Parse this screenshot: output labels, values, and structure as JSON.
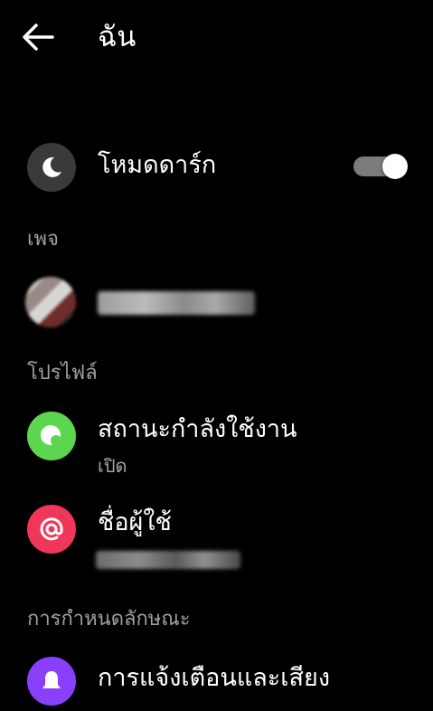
{
  "header": {
    "title": "ฉัน"
  },
  "dark_mode": {
    "label": "โหมดดาร์ก",
    "enabled": true
  },
  "sections": {
    "page": "เพจ",
    "profile": "โปรไฟล์",
    "preferences": "การกำหนดลักษณะ"
  },
  "active_status": {
    "label": "สถานะกำลังใช้งาน",
    "value": "เปิด"
  },
  "username": {
    "label": "ชื่อผู้ใช้"
  },
  "notifications": {
    "label": "การแจ้งเตือนและเสียง"
  },
  "colors": {
    "moon_bg": "#3a3a3c",
    "active_green": "#5dd64f",
    "username_pink": "#f0375a",
    "notif_purple": "#8a3ffc"
  }
}
